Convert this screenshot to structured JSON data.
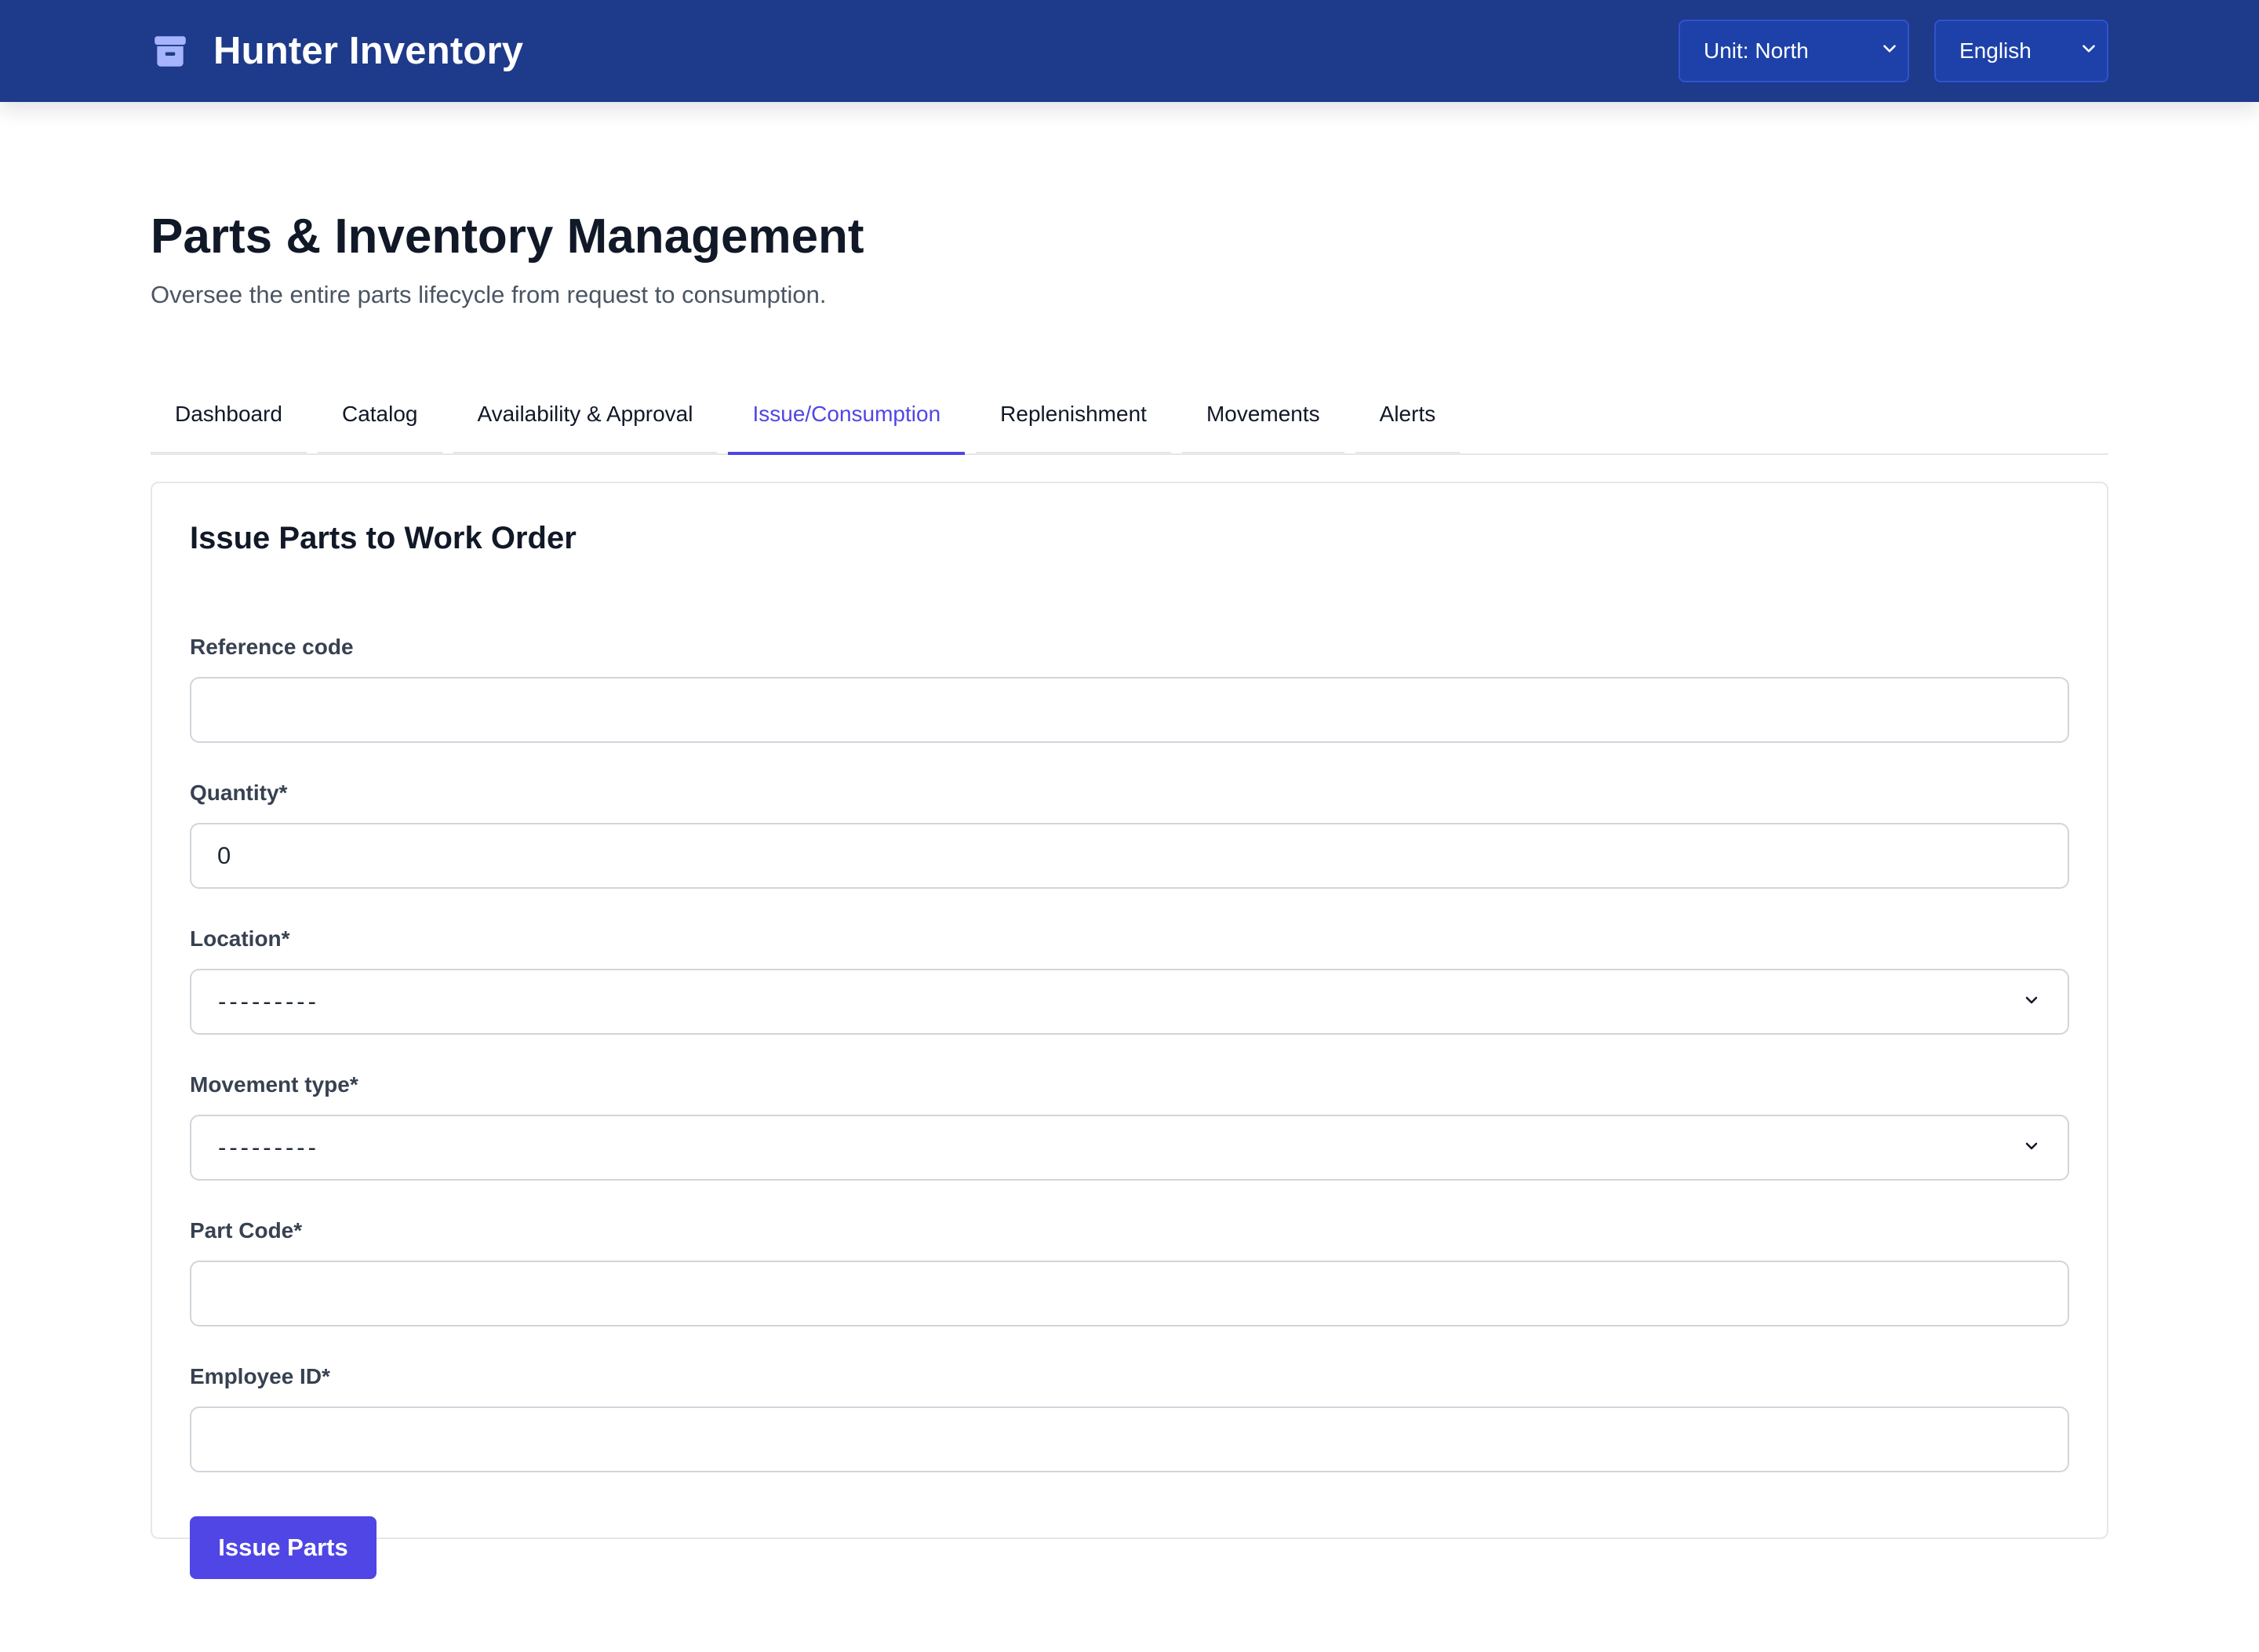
{
  "header": {
    "brand_title": "Hunter Inventory",
    "brand_icon": "archive-box-icon",
    "unit_selector": {
      "selected": "Unit: North",
      "icon": "chevron-down-icon"
    },
    "language_selector": {
      "selected": "English",
      "icon": "chevron-down-icon"
    }
  },
  "page": {
    "title": "Parts & Inventory Management",
    "subtitle": "Oversee the entire parts lifecycle from request to consumption."
  },
  "tabs": [
    {
      "label": "Dashboard",
      "active": false
    },
    {
      "label": "Catalog",
      "active": false
    },
    {
      "label": "Availability & Approval",
      "active": false
    },
    {
      "label": "Issue/Consumption",
      "active": true
    },
    {
      "label": "Replenishment",
      "active": false
    },
    {
      "label": "Movements",
      "active": false
    },
    {
      "label": "Alerts",
      "active": false
    }
  ],
  "form": {
    "title": "Issue Parts to Work Order",
    "fields": {
      "reference_code": {
        "label": "Reference code",
        "value": ""
      },
      "quantity": {
        "label": "Quantity*",
        "value": "0"
      },
      "location": {
        "label": "Location*",
        "selected": "---------"
      },
      "movement_type": {
        "label": "Movement type*",
        "selected": "---------"
      },
      "part_code": {
        "label": "Part Code*",
        "value": ""
      },
      "employee_id": {
        "label": "Employee ID*",
        "value": ""
      }
    },
    "submit_label": "Issue Parts"
  },
  "colors": {
    "header_bg": "#1e3a8a",
    "accent": "#4f46e5",
    "border": "#d1d5db"
  }
}
